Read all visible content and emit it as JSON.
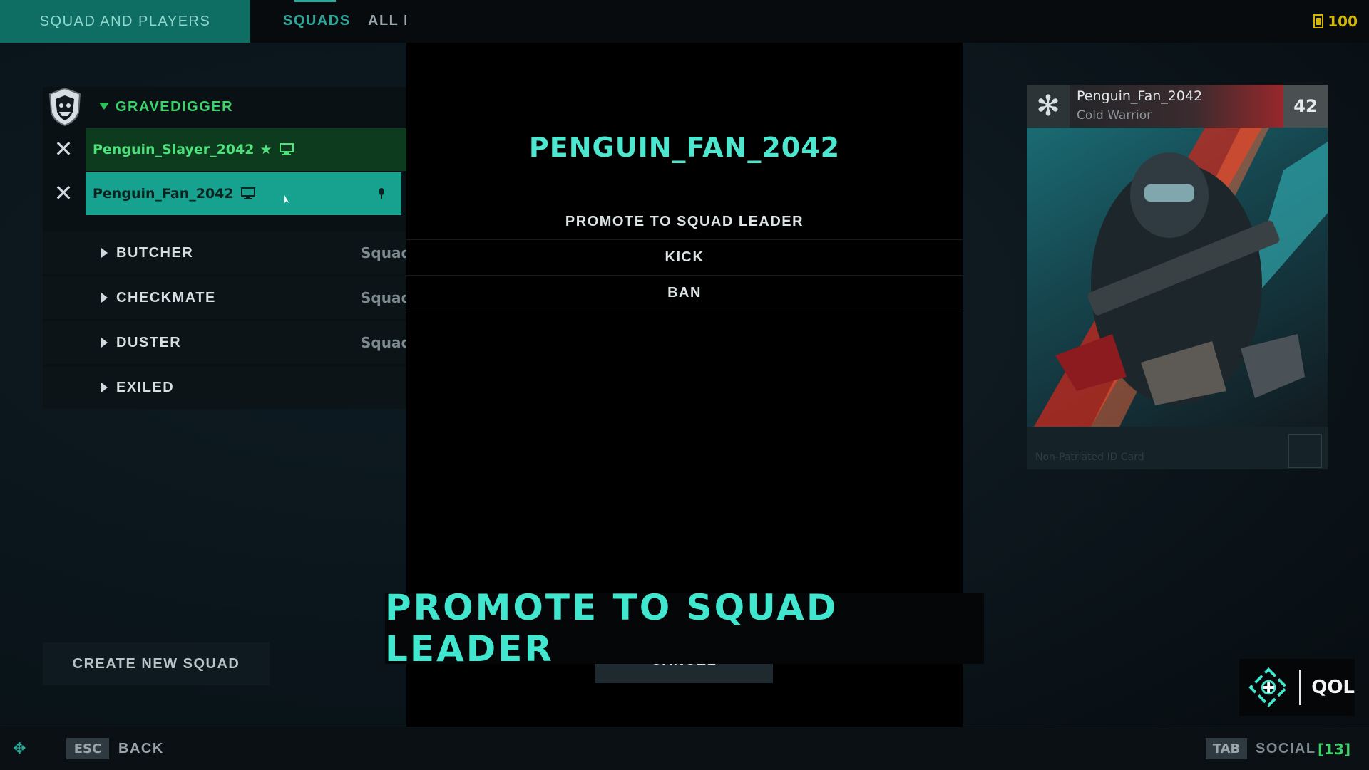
{
  "header": {
    "tabs": [
      {
        "label": "SQUAD AND PLAYERS"
      },
      {
        "label": "SQUADS"
      },
      {
        "label": "ALL P"
      }
    ],
    "currency": {
      "value": "100",
      "icon": "currency-icon"
    }
  },
  "squads": {
    "expanded": {
      "name": "GRAVEDIGGER",
      "members": [
        {
          "name": "Penguin_Slayer_2042",
          "leader_icon": "★",
          "platform_icon": "pc-icon"
        },
        {
          "name": "Penguin_Fan_2042",
          "platform_icon": "pc-icon",
          "mic_icon": "mic-icon"
        }
      ]
    },
    "collapsed": [
      {
        "name": "BUTCHER",
        "type": "Squad"
      },
      {
        "name": "CHECKMATE",
        "type": "Squad"
      },
      {
        "name": "DUSTER",
        "type": "Squad"
      },
      {
        "name": "EXILED"
      }
    ],
    "create_button": "CREATE NEW SQUAD"
  },
  "modal": {
    "title": "PENGUIN_FAN_2042",
    "options": [
      "PROMOTE TO SQUAD LEADER",
      "KICK",
      "BAN"
    ],
    "cancel": "CANCEL"
  },
  "caption": "PROMOTE TO SQUAD LEADER",
  "player_card": {
    "name": "Penguin_Fan_2042",
    "subtitle": "Cold Warrior",
    "level": "42",
    "footer": "Non-Patriated ID Card",
    "icon": "snowflake-icon"
  },
  "badge": {
    "text": "QOL",
    "icon": "crosshair-plus-icon"
  },
  "footer": {
    "back_key": "ESC",
    "back_label": "BACK",
    "social_key": "TAB",
    "social_label": "SOCIAL",
    "social_count": "[13]"
  },
  "colors": {
    "accent": "#2aa99b",
    "leader_green": "#3dd26a",
    "caption": "#40e6cd"
  }
}
